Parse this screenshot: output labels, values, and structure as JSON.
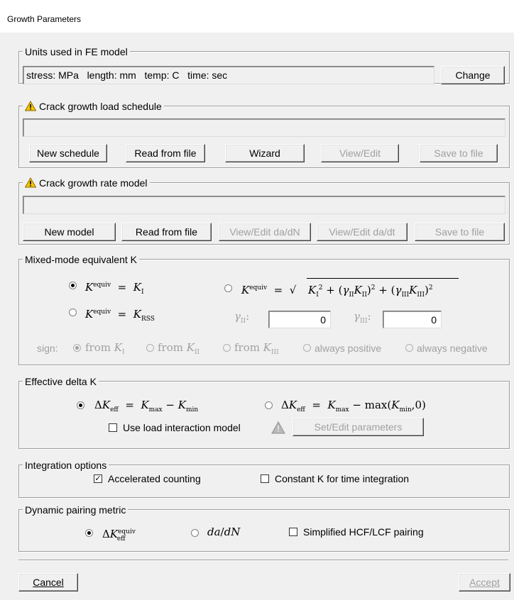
{
  "window": {
    "title": "Growth Parameters"
  },
  "units": {
    "legend": "Units used in FE model",
    "value": "stress: MPa   length: mm   temp: C   time: sec",
    "change_label": "Change"
  },
  "load_schedule": {
    "legend": "Crack growth load schedule",
    "warning_icon": "warning-icon",
    "value": "",
    "new_label": "New schedule",
    "read_label": "Read from file",
    "wizard_label": "Wizard",
    "view_label": "View/Edit",
    "save_label": "Save to file"
  },
  "rate_model": {
    "legend": "Crack growth rate model",
    "value": "",
    "new_label": "New model",
    "read_label": "Read from file",
    "view_dadn_label": "View/Edit da/dN",
    "view_dadt_label": "View/Edit da/dt",
    "save_label": "Save to file"
  },
  "mixed_mode": {
    "legend": "Mixed-mode equivalent K",
    "gamma_II_value": "0",
    "gamma_III_value": "0",
    "sign_label": "sign:",
    "from_label": "from",
    "always_positive": "always positive",
    "always_negative": "always negative",
    "selected": "K_equiv_eq_KI"
  },
  "effective_delta_k": {
    "legend": "Effective delta K",
    "load_interaction_label": "Use load interaction model",
    "set_edit_label": "Set/Edit parameters",
    "load_interaction_checked": false
  },
  "integration": {
    "legend": "Integration options",
    "accelerated_label": "Accelerated counting",
    "accelerated_checked": true,
    "constant_k_label": "Constant K for time integration",
    "constant_k_checked": false
  },
  "pairing": {
    "legend": "Dynamic pairing metric",
    "simplified_label": "Simplified HCF/LCF pairing",
    "simplified_checked": false
  },
  "footer": {
    "cancel_label": "Cancel",
    "accept_label": "Accept"
  }
}
